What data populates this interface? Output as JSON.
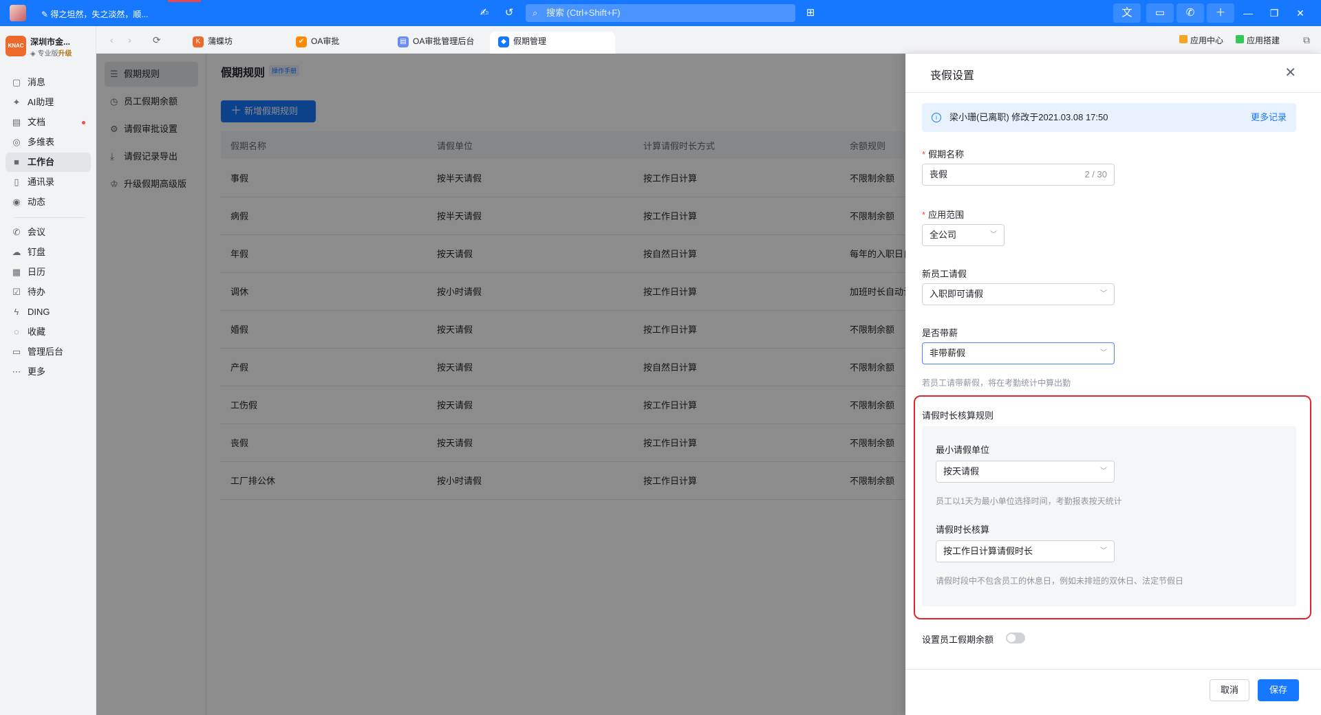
{
  "titlebar": {
    "signature": "得之坦然，失之淡然，顺...",
    "search_placeholder": "搜索 (Ctrl+Shift+F)"
  },
  "org": {
    "name": "深圳市金...",
    "tier": "专业版",
    "upgrade": "升级"
  },
  "leftnav": [
    {
      "label": "消息",
      "icon": "chat-bubble-icon"
    },
    {
      "label": "AI助理",
      "icon": "sparkle-icon"
    },
    {
      "label": "文档",
      "icon": "document-icon"
    },
    {
      "label": "多维表",
      "icon": "table-icon"
    },
    {
      "label": "工作台",
      "icon": "grid-icon"
    },
    {
      "label": "通讯录",
      "icon": "contacts-icon"
    },
    {
      "label": "动态",
      "icon": "activity-icon"
    },
    {
      "label": "会议",
      "icon": "phone-icon"
    },
    {
      "label": "钉盘",
      "icon": "cloud-drive-icon"
    },
    {
      "label": "日历",
      "icon": "calendar-icon"
    },
    {
      "label": "待办",
      "icon": "checkbox-icon"
    },
    {
      "label": "DING",
      "icon": "lightning-icon"
    },
    {
      "label": "收藏",
      "icon": "favorite-icon"
    },
    {
      "label": "管理后台",
      "icon": "monitor-icon"
    },
    {
      "label": "更多",
      "icon": "more-icon"
    }
  ],
  "tabs": [
    {
      "label": "蒲蝶坊"
    },
    {
      "label": "OA审批"
    },
    {
      "label": "OA审批管理后台"
    },
    {
      "label": "假期管理"
    }
  ],
  "toolbar": {
    "app_center": "应用中心",
    "app_builder": "应用搭建"
  },
  "subnav": [
    {
      "label": "假期规则"
    },
    {
      "label": "员工假期余额"
    },
    {
      "label": "请假审批设置"
    },
    {
      "label": "请假记录导出"
    },
    {
      "label": "升级假期高级版"
    }
  ],
  "main": {
    "title": "假期规则",
    "manual_badge": "操作手册",
    "add_button": "新增假期规则",
    "columns": [
      "假期名称",
      "请假单位",
      "计算请假时长方式",
      "余额规则"
    ],
    "rows": [
      [
        "事假",
        "按半天请假",
        "按工作日计算",
        "不限制余额"
      ],
      [
        "病假",
        "按半天请假",
        "按工作日计算",
        "不限制余额"
      ],
      [
        "年假",
        "按天请假",
        "按自然日计算",
        "每年的入职日自"
      ],
      [
        "调休",
        "按小时请假",
        "按工作日计算",
        "加班时长自动计"
      ],
      [
        "婚假",
        "按天请假",
        "按工作日计算",
        "不限制余额"
      ],
      [
        "产假",
        "按天请假",
        "按自然日计算",
        "不限制余额"
      ],
      [
        "工伤假",
        "按天请假",
        "按工作日计算",
        "不限制余额"
      ],
      [
        "丧假",
        "按天请假",
        "按工作日计算",
        "不限制余额"
      ],
      [
        "工厂排公休",
        "按小时请假",
        "按工作日计算",
        "不限制余额"
      ]
    ]
  },
  "drawer": {
    "title": "丧假设置",
    "info": "梁小珊(已离职) 修改于2021.03.08 17:50",
    "more_records": "更多记录",
    "name_label": "假期名称",
    "name_value": "丧假",
    "name_count": "2 / 30",
    "scope_label": "应用范围",
    "scope_value": "全公司",
    "newhire_label": "新员工请假",
    "newhire_value": "入职即可请假",
    "paid_label": "是否带薪",
    "paid_value": "非带薪假",
    "paid_hint": "若员工请带薪假，将在考勤统计中算出勤",
    "rule_title": "请假时长核算规则",
    "min_unit_label": "最小请假单位",
    "min_unit_value": "按天请假",
    "min_unit_hint": "员工以1天为最小单位选择时间，考勤报表按天统计",
    "calc_label": "请假时长核算",
    "calc_value": "按工作日计算请假时长",
    "calc_hint": "请假时段中不包含员工的休息日，例如未排班的双休日、法定节假日",
    "balance_label": "设置员工假期余额",
    "balance_enabled": false,
    "cancel": "取消",
    "save": "保存"
  }
}
